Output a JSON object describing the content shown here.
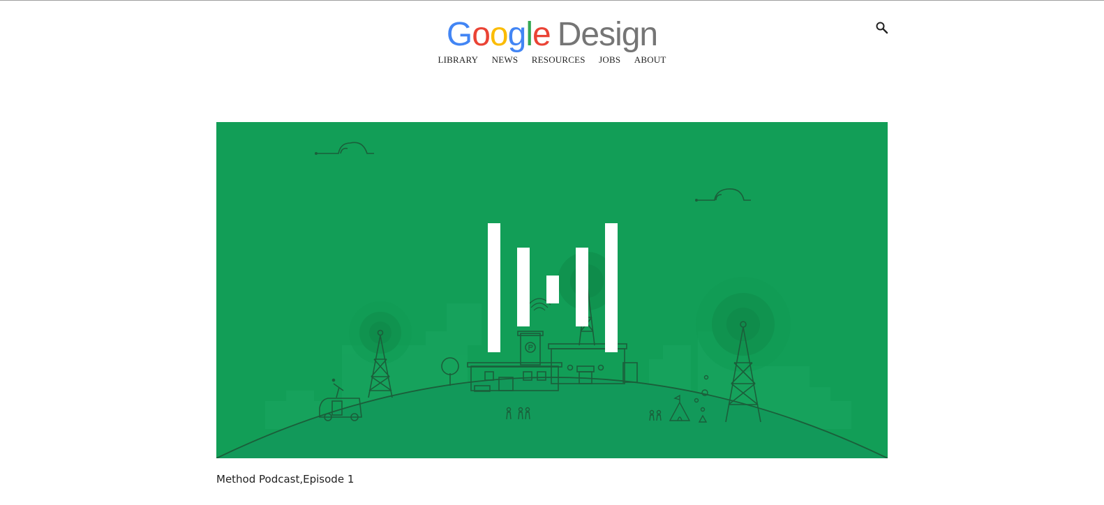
{
  "header": {
    "logo_letters": [
      {
        "char": "G",
        "color": "#4285F4"
      },
      {
        "char": "o",
        "color": "#EA4335"
      },
      {
        "char": "o",
        "color": "#FBBC05"
      },
      {
        "char": "g",
        "color": "#4285F4"
      },
      {
        "char": "l",
        "color": "#34A853"
      },
      {
        "char": "e",
        "color": "#EA4335"
      }
    ],
    "logo_suffix": "Design",
    "logo_suffix_color": "#757575",
    "search_icon": "search-icon"
  },
  "nav": {
    "items": [
      {
        "label": "LIBRARY"
      },
      {
        "label": "NEWS"
      },
      {
        "label": "RESOURCES"
      },
      {
        "label": "JOBS"
      },
      {
        "label": "ABOUT"
      }
    ]
  },
  "hero": {
    "background_color": "#129e57",
    "illustration": "method-podcast-illustration"
  },
  "caption": {
    "text": "Method Podcast,Episode 1"
  }
}
